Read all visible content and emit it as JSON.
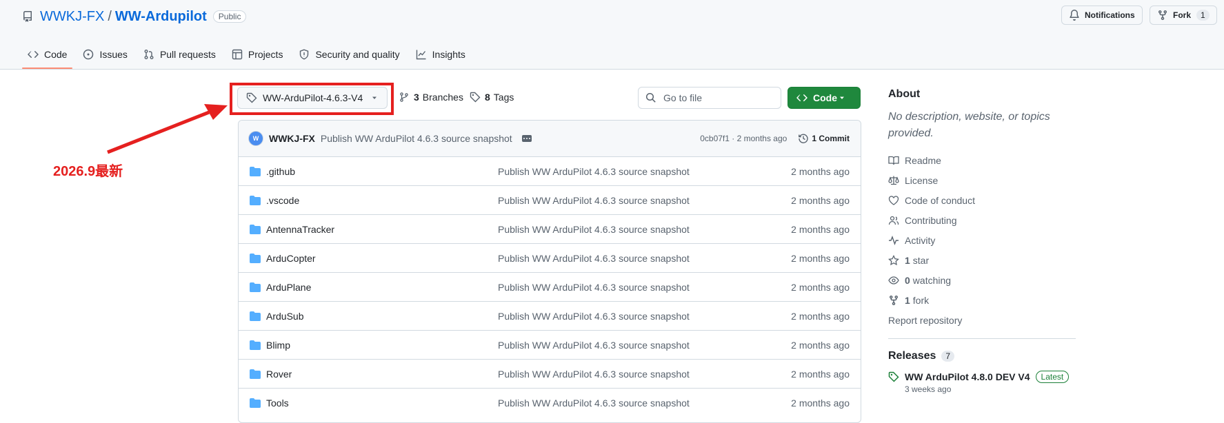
{
  "header": {
    "owner": "WWKJ-FX",
    "separator": "/",
    "repo": "WW-Ardupilot",
    "visibility": "Public",
    "notifications_label": "Notifications",
    "fork_label": "Fork",
    "fork_count": "1"
  },
  "tabs": [
    {
      "label": "Code",
      "icon": "code-icon"
    },
    {
      "label": "Issues",
      "icon": "issue-icon"
    },
    {
      "label": "Pull requests",
      "icon": "pull-request-icon"
    },
    {
      "label": "Projects",
      "icon": "table-icon"
    },
    {
      "label": "Security and quality",
      "icon": "shield-icon"
    },
    {
      "label": "Insights",
      "icon": "graph-icon"
    }
  ],
  "toolbar": {
    "branch": "WW-ArduPilot-4.6.3-V4",
    "branches_count": "3",
    "branches_label": "Branches",
    "tags_count": "8",
    "tags_label": "Tags",
    "go_to_file_placeholder": "Go to file",
    "code_button": "Code"
  },
  "commit": {
    "avatar_text": "W",
    "author": "WWKJ-FX",
    "message": "Publish WW ArduPilot 4.6.3 source snapshot",
    "sha_time": "0cb07f1 · 2 months ago",
    "commits_label": "1 Commit"
  },
  "files": [
    {
      "name": ".github",
      "message": "Publish WW ArduPilot 4.6.3 source snapshot",
      "age": "2 months ago"
    },
    {
      "name": ".vscode",
      "message": "Publish WW ArduPilot 4.6.3 source snapshot",
      "age": "2 months ago"
    },
    {
      "name": "AntennaTracker",
      "message": "Publish WW ArduPilot 4.6.3 source snapshot",
      "age": "2 months ago"
    },
    {
      "name": "ArduCopter",
      "message": "Publish WW ArduPilot 4.6.3 source snapshot",
      "age": "2 months ago"
    },
    {
      "name": "ArduPlane",
      "message": "Publish WW ArduPilot 4.6.3 source snapshot",
      "age": "2 months ago"
    },
    {
      "name": "ArduSub",
      "message": "Publish WW ArduPilot 4.6.3 source snapshot",
      "age": "2 months ago"
    },
    {
      "name": "Blimp",
      "message": "Publish WW ArduPilot 4.6.3 source snapshot",
      "age": "2 months ago"
    },
    {
      "name": "Rover",
      "message": "Publish WW ArduPilot 4.6.3 source snapshot",
      "age": "2 months ago"
    },
    {
      "name": "Tools",
      "message": "Publish WW ArduPilot 4.6.3 source snapshot",
      "age": "2 months ago"
    }
  ],
  "about": {
    "title": "About",
    "description": "No description, website, or topics provided.",
    "links": [
      {
        "label": "Readme",
        "icon": "book-icon"
      },
      {
        "label": "License",
        "icon": "law-icon"
      },
      {
        "label": "Code of conduct",
        "icon": "code-of-conduct-icon"
      },
      {
        "label": "Contributing",
        "icon": "people-icon"
      },
      {
        "label": "Activity",
        "icon": "pulse-icon"
      }
    ],
    "stars_count": "1",
    "stars_label": "star",
    "watching_count": "0",
    "watching_label": "watching",
    "forks_count": "1",
    "forks_label": "fork",
    "report": "Report repository"
  },
  "releases": {
    "title": "Releases",
    "count": "7",
    "latest_name": "WW ArduPilot 4.8.0 DEV V4",
    "latest_badge": "Latest",
    "latest_date": "3 weeks ago"
  },
  "annotation": {
    "text": "2026.9最新",
    "color": "#e5201f"
  },
  "colors": {
    "link": "#0969da",
    "code_button": "#1f883d",
    "folder": "#54aeff",
    "active_tab": "#fd8c73",
    "muted": "#59636e"
  }
}
